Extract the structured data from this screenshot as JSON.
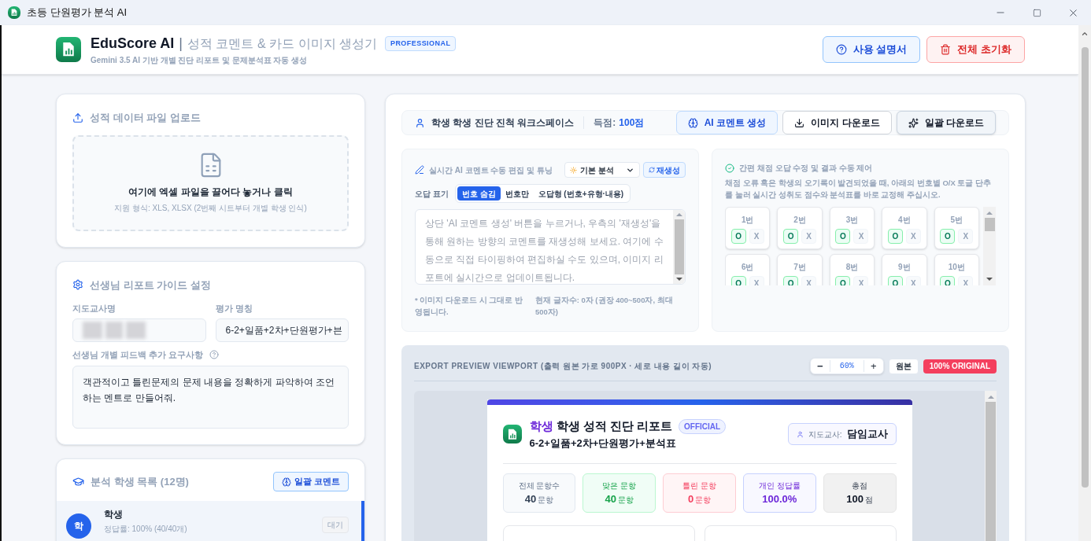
{
  "window": {
    "title": "초등 단원평가 분석 AI"
  },
  "header": {
    "brand": "EduScore AI",
    "separator": "|",
    "subtitle": "성적 코멘트 & 카드 이미지 생성기",
    "badge": "PROFESSIONAL",
    "tagline": "Gemini 3.5 AI 기반 개별 진단 리포트 및 문제분석표 자동 생성",
    "buttons": [
      {
        "label": "사용 설명서",
        "kind": "help"
      },
      {
        "label": "전체 초기화",
        "kind": "reset"
      }
    ]
  },
  "upload": {
    "title": "성적 데이터 파일 업로드",
    "drop_text": "여기에 엑셀 파일을 끌어다 놓거나 클릭",
    "hint": "지원 형식: XLS, XLSX (2번째 시트부터 개별 학생 인식)"
  },
  "guide": {
    "title": "선생님 리포트 가이드 설정",
    "teacher_label": "지도교사명",
    "exam_label": "평가 명칭",
    "exam_value": "6-2+일품+2차+단원평가+븐",
    "request_label": "선생님 개별 피드백 추가 요구사항",
    "request_value": "객관적이고 틀린문제의 문제 내용을 정확하게 파악하여 조언하는 멘트로 만들어줘."
  },
  "students": {
    "title": "분석 학생 목록 (12명)",
    "batch_button": "일괄 코멘트",
    "items": [
      {
        "avatar": "학",
        "name": "학생",
        "detail": "정답률: 100% (40/40개)",
        "status": "대기",
        "selected": true
      }
    ]
  },
  "workspace": {
    "title": "학생 학생 진단 진척 워크스페이스",
    "score_label": "득점:",
    "score_value": "100점",
    "actions": [
      {
        "label": "AI 코멘트 생성",
        "kind": "ai"
      },
      {
        "label": "이미지 다운로드",
        "kind": "download"
      },
      {
        "label": "일괄 다운로드",
        "kind": "batch"
      }
    ]
  },
  "editor": {
    "title": "실시간 AI 코멘트 수동 편집 및 튜닝",
    "mode": "기본 분석",
    "regen": "재생성",
    "marking_label": "오답 표기",
    "marking_tabs": [
      {
        "label": "번호 숨김",
        "selected": true
      },
      {
        "label": "번호만",
        "selected": false
      },
      {
        "label": "오답형 (번호+유형·내용)",
        "selected": false
      }
    ],
    "placeholder": "상단 'AI 코멘트 생성' 버튼을 누르거나, 우측의 '재생성'을 통해 원하는 방향의 코멘트를 재생성해 보세요. 여기에 수동으로 직접 타이핑하여 편집하실 수도 있으며, 이미지 리포트에 실시간으로 업데이트됩니다.",
    "note": "* 이미지 다운로드 시 그대로 반영됩니다.",
    "count": "현재 글자수: 0자 (권장 400~500자, 최대 500자)"
  },
  "grading": {
    "title": "간편 채점 오답 수정 및 결과 수동 제어",
    "description": "채점 오류 혹은 학생의 오기록이 발견되었을 때, 아래의 번호별 O/X 토글 단추를 눌러 실시간 성취도 점수와 분석표를 바로 교정해 주십시오.",
    "questions": [
      {
        "label": "1번",
        "o": "O",
        "x": "X",
        "correct": true
      },
      {
        "label": "2번",
        "o": "O",
        "x": "X",
        "correct": true
      },
      {
        "label": "3번",
        "o": "O",
        "x": "X",
        "correct": true
      },
      {
        "label": "4번",
        "o": "O",
        "x": "X",
        "correct": true
      },
      {
        "label": "5번",
        "o": "O",
        "x": "X",
        "correct": true
      },
      {
        "label": "6번",
        "o": "O",
        "x": "X",
        "correct": true
      },
      {
        "label": "7번",
        "o": "O",
        "x": "X",
        "correct": true
      },
      {
        "label": "8번",
        "o": "O",
        "x": "X",
        "correct": true
      },
      {
        "label": "9번",
        "o": "O",
        "x": "X",
        "correct": true
      },
      {
        "label": "10번",
        "o": "O",
        "x": "X",
        "correct": true
      }
    ]
  },
  "preview": {
    "title": "EXPORT PREVIEW VIEWPORT (출력 원본 가로 900PX · 세로 내용 길이 자동)",
    "zoom_minus": "−",
    "zoom": "60%",
    "zoom_plus": "+",
    "original": "원본",
    "original_badge": "100% ORIGINAL",
    "report": {
      "highlight": "학생",
      "title": "학생 성적 진단 리포트",
      "badge": "OFFICIAL",
      "exam": "6-2+일품+2차+단원평가+분석표",
      "teacher_label": "지도교사:",
      "teacher": "담임교사",
      "stats": [
        {
          "label": "전체 문항수",
          "value": "40",
          "unit": "문항",
          "kind": "neutral"
        },
        {
          "label": "맞은 문항",
          "value": "40",
          "unit": "문항",
          "kind": "good"
        },
        {
          "label": "틀린 문항",
          "value": "0",
          "unit": "문항",
          "kind": "bad"
        },
        {
          "label": "개인 정답률",
          "value": "100.0%",
          "kind": "rate"
        },
        {
          "label": "총점",
          "value": "100",
          "unit": "점",
          "kind": "total"
        }
      ]
    }
  }
}
